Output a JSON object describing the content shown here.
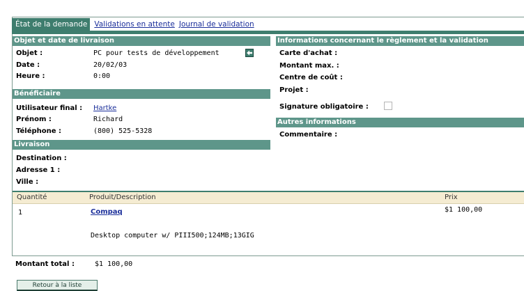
{
  "tabs": {
    "active": "État de la demande",
    "links": [
      "Validations en attente",
      "Journal de validation"
    ]
  },
  "left": {
    "section1_title": "Objet et date de livraison",
    "objet_label": "Objet :",
    "objet_value": "PC pour tests de développement",
    "date_label": "Date :",
    "date_value": "20/02/03",
    "heure_label": "Heure :",
    "heure_value": "0:00",
    "section2_title": "Bénéficiaire",
    "user_label": "Utilisateur final :",
    "user_value": "Hartke",
    "prenom_label": "Prénom :",
    "prenom_value": "Richard",
    "tel_label": "Téléphone :",
    "tel_value": "(800) 525-5328",
    "section3_title": "Livraison",
    "destination_label": "Destination :",
    "adresse_label": "Adresse 1 :",
    "ville_label": "Ville :"
  },
  "right": {
    "section1_title": "Informations concernant le règlement et la validation",
    "carte_label": "Carte d'achat :",
    "montant_label": "Montant max. :",
    "centre_label": "Centre de coût :",
    "projet_label": "Projet :",
    "signature_label": "Signature obligatoire :",
    "section2_title": "Autres informations",
    "commentaire_label": "Commentaire :"
  },
  "table": {
    "headers": [
      "Quantité",
      "Produit/Description",
      "Prix"
    ],
    "row": {
      "quantity": "1",
      "product": "Compaq",
      "description": "Desktop computer w/ PIII500;124MB;13GIG",
      "price": "$1 100,00"
    }
  },
  "total": {
    "label": "Montant total :",
    "value": "$1 100,00"
  },
  "back_button": "Retour à la liste",
  "colors": {
    "tab_active": "#3e7d6e",
    "section_header": "#5e968a",
    "table_header_bg": "#f5ecd2",
    "link": "#1a2e9a"
  }
}
